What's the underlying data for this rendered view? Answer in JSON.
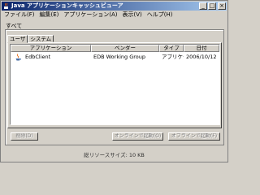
{
  "window": {
    "title": "Java アプリケーションキャッシュビューア",
    "minimize": "_",
    "maximize": "□",
    "close": "×"
  },
  "menubar": {
    "items": [
      "ファイル(F)",
      "編集(E)",
      "アプリケーション(A)",
      "表示(V)",
      "ヘルプ(H)"
    ]
  },
  "group_label": "すべて",
  "tabs": [
    {
      "label": "ユーザ"
    },
    {
      "label": "システム"
    }
  ],
  "table": {
    "columns": [
      "アプリケーション",
      "ベンダー",
      "タイプ",
      "日付"
    ],
    "rows": [
      {
        "application": "EdbClient",
        "vendor": "EDB Working Group",
        "type": "アプリケーシ...",
        "date": "2006/10/12"
      }
    ]
  },
  "buttons": {
    "delete": "削除(D)",
    "launch_online": "オンラインで起動(O)",
    "launch_offline": "オフラインで起動(F)"
  },
  "status": {
    "text": "総リソースサイズ: 10 KB"
  },
  "colors": {
    "title_start": "#0a246a",
    "title_end": "#a6caf0",
    "face": "#d4d0c8"
  }
}
